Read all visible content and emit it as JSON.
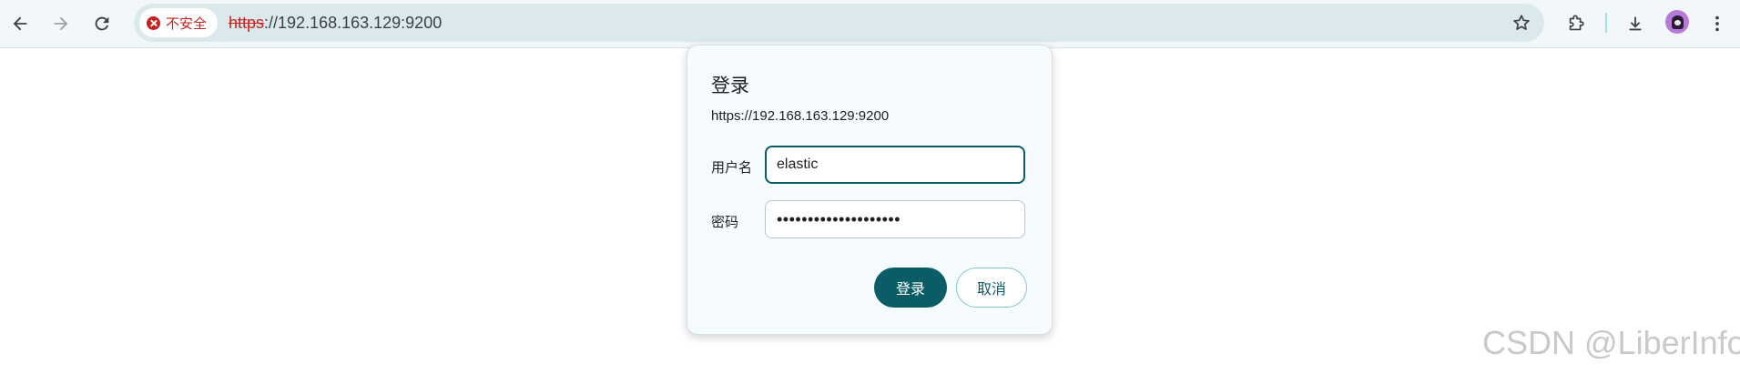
{
  "toolbar": {
    "back_icon": "arrow-left-icon",
    "forward_icon": "arrow-right-icon",
    "reload_icon": "reload-icon",
    "security_chip_label": "不安全",
    "url_scheme": "https",
    "url_rest": "://192.168.163.129:9200",
    "bookmark_icon": "star-icon",
    "extensions_icon": "puzzle-icon",
    "download_icon": "download-icon",
    "menu_icon": "kebab-menu-icon"
  },
  "dialog": {
    "title": "登录",
    "origin": "https://192.168.163.129:9200",
    "username_label": "用户名",
    "username_value": "elastic",
    "password_label": "密码",
    "password_value": "••••••••••••••••••••",
    "login_button": "登录",
    "cancel_button": "取消"
  },
  "watermark": "CSDN @LiberInfo",
  "colors": {
    "accent": "#0a5c66",
    "insecure": "#c5221f",
    "toolbar_bg": "#f2f8fa",
    "omnibox_bg": "#dbe8ec"
  }
}
